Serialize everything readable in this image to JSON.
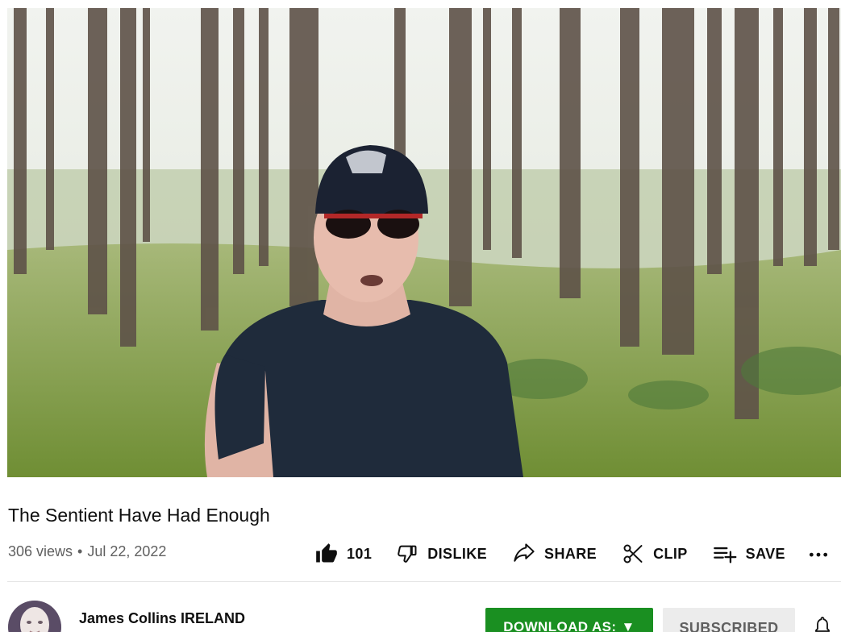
{
  "video": {
    "title": "The Sentient Have Had Enough",
    "views": "306 views",
    "separator": "•",
    "date": "Jul 22, 2022"
  },
  "actions": {
    "like_count": "101",
    "dislike_label": "DISLIKE",
    "share_label": "SHARE",
    "clip_label": "CLIP",
    "save_label": "SAVE",
    "more_label": "•••"
  },
  "channel": {
    "name": "James Collins IRELAND",
    "download_label": "DOWNLOAD AS:",
    "download_arrow": "▼",
    "subscribed_label": "SUBSCRIBED"
  },
  "icons": {
    "like": "thumb-up-icon",
    "dislike": "thumb-down-icon",
    "share": "share-arrow-icon",
    "clip": "scissors-icon",
    "save": "playlist-add-icon",
    "more": "more-horizontal-icon",
    "bell": "bell-icon"
  },
  "colors": {
    "download_button": "#1a8f21",
    "subscribed_button": "#ececec",
    "meta_text": "#606060"
  }
}
